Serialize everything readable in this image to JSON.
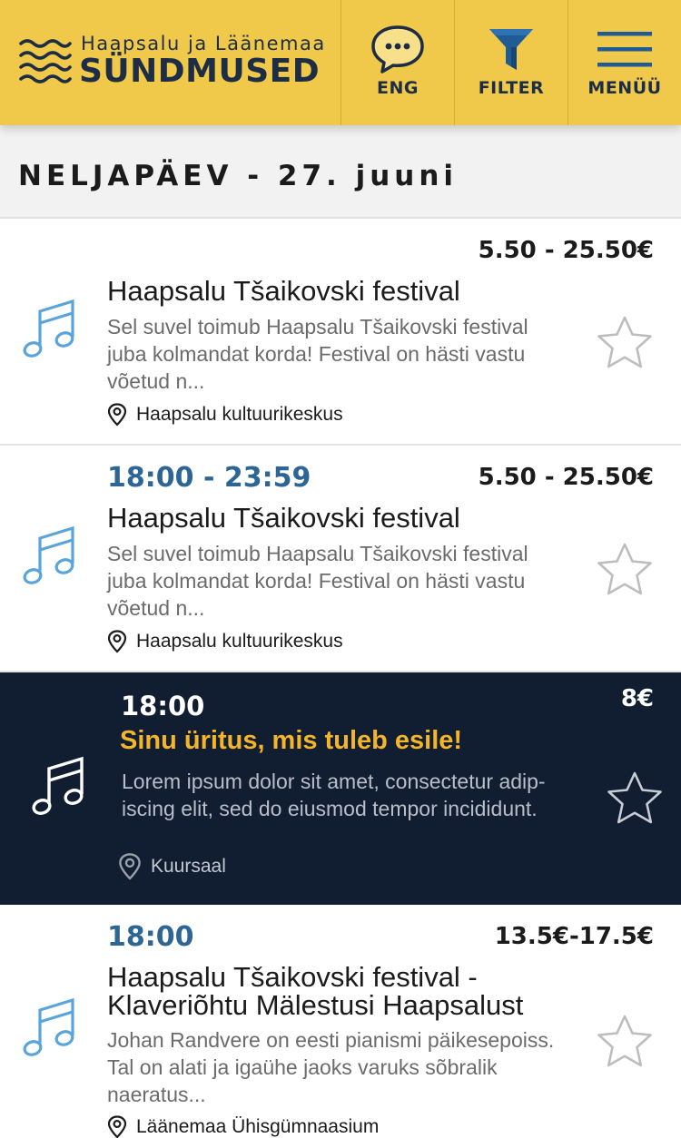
{
  "header": {
    "logo_subtitle": "Haapsalu ja Läänemaa",
    "logo_title": "SÜNDMUSED",
    "buttons": [
      {
        "label": "ENG",
        "icon": "chat-bubble-icon"
      },
      {
        "label": "FILTER",
        "icon": "funnel-icon"
      },
      {
        "label": "MENÜÜ",
        "icon": "hamburger-icon"
      }
    ]
  },
  "date_heading": "NELJAPÄEV - 27. juuni",
  "colors": {
    "header_bg": "#f0c94a",
    "brand_dark": "#1c2d45",
    "time_blue": "#2d6594",
    "icon_blue": "#5aa4dc",
    "featured_bg": "#111d30",
    "featured_title": "#f4b52a"
  },
  "events": [
    {
      "time": "",
      "price": "5.50 - 25.50€",
      "title": "Haapsalu Tšaikovski festival",
      "description_lines": [
        "Sel suvel toimub Haapsalu Tšaikovski festival",
        "juba kolmandat korda! Festival on hästi vastu",
        "võetud n..."
      ],
      "location": "Haapsalu kultuurikeskus",
      "icon": "music-note-icon",
      "featured": false
    },
    {
      "time": "18:00 - 23:59",
      "price": "5.50 - 25.50€",
      "title": "Haapsalu Tšaikovski festival",
      "description_lines": [
        "Sel suvel toimub Haapsalu Tšaikovski festival",
        "juba kolmandat korda! Festival on hästi vastu",
        "võetud n..."
      ],
      "location": "Haapsalu kultuurikeskus",
      "icon": "music-note-icon",
      "featured": false
    },
    {
      "time": "18:00",
      "price": "8€",
      "title": "Sinu üritus, mis tuleb esile!",
      "description_lines": [
        "Lorem ipsum dolor sit amet, consectetur adip-",
        "iscing elit, sed do eiusmod tempor incididunt."
      ],
      "location": "Kuursaal",
      "icon": "music-note-icon",
      "featured": true
    },
    {
      "time": "18:00",
      "price": "13.5€-17.5€",
      "title_lines": [
        "Haapsalu Tšaikovski festival -",
        "Klaveriõhtu Mälestusi Haapsalust"
      ],
      "description_lines": [
        "Johan Randvere on eesti pianismi päikesepoiss.",
        "Tal on alati ja igaühe jaoks varuks sõbralik",
        "naeratus..."
      ],
      "location": "Läänemaa Ühisgümnaasium",
      "icon": "music-note-icon",
      "featured": false
    }
  ]
}
